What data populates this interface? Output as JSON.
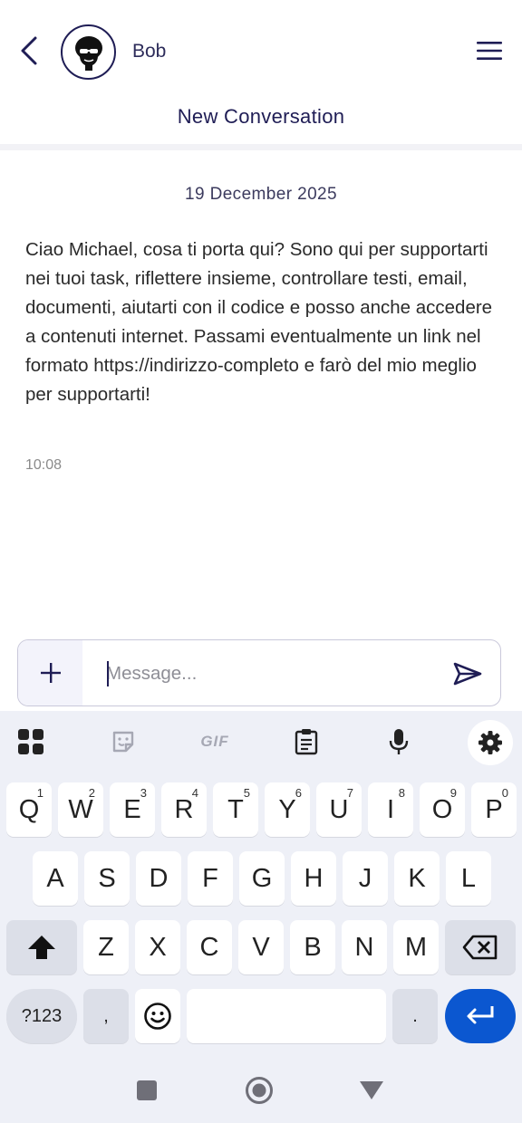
{
  "header": {
    "contact_name": "Bob",
    "conversation_title": "New Conversation"
  },
  "chat": {
    "date": "19 December 2025",
    "messages": [
      {
        "text": "Ciao Michael, cosa ti porta qui? Sono qui per supportarti nei tuoi task, riflettere insieme, controllare testi, email, documenti, aiutarti con il codice e posso anche accedere a contenuti internet. Passami eventualmente un link nel formato https://indirizzo-completo e farò del mio meglio per supportarti!",
        "time": "10:08"
      }
    ]
  },
  "composer": {
    "placeholder": "Message..."
  },
  "keyboard": {
    "toolbar": {
      "gif_label": "GIF"
    },
    "row1": [
      {
        "key": "Q",
        "hint": "1"
      },
      {
        "key": "W",
        "hint": "2"
      },
      {
        "key": "E",
        "hint": "3"
      },
      {
        "key": "R",
        "hint": "4"
      },
      {
        "key": "T",
        "hint": "5"
      },
      {
        "key": "Y",
        "hint": "6"
      },
      {
        "key": "U",
        "hint": "7"
      },
      {
        "key": "I",
        "hint": "8"
      },
      {
        "key": "O",
        "hint": "9"
      },
      {
        "key": "P",
        "hint": "0"
      }
    ],
    "row2": [
      "A",
      "S",
      "D",
      "F",
      "G",
      "H",
      "J",
      "K",
      "L"
    ],
    "row3": [
      "Z",
      "X",
      "C",
      "V",
      "B",
      "N",
      "M"
    ],
    "symbols_label": "?123",
    "comma_label": ",",
    "period_label": "."
  },
  "colors": {
    "accent": "#1f1d55",
    "enter_key": "#0b57d0",
    "keyboard_bg": "#eef0f7"
  },
  "icons": {
    "back": "chevron-left-icon",
    "menu": "hamburger-menu-icon",
    "attach": "plus-icon",
    "send": "send-icon",
    "apps": "apps-grid-icon",
    "sticker": "sticker-icon",
    "clipboard": "clipboard-icon",
    "mic": "microphone-icon",
    "settings": "gear-icon",
    "shift": "shift-arrow-icon",
    "backspace": "backspace-icon",
    "emoji": "smiley-icon",
    "enter": "enter-icon",
    "nav_recents": "square-icon",
    "nav_home": "circle-icon",
    "nav_back": "triangle-icon"
  }
}
